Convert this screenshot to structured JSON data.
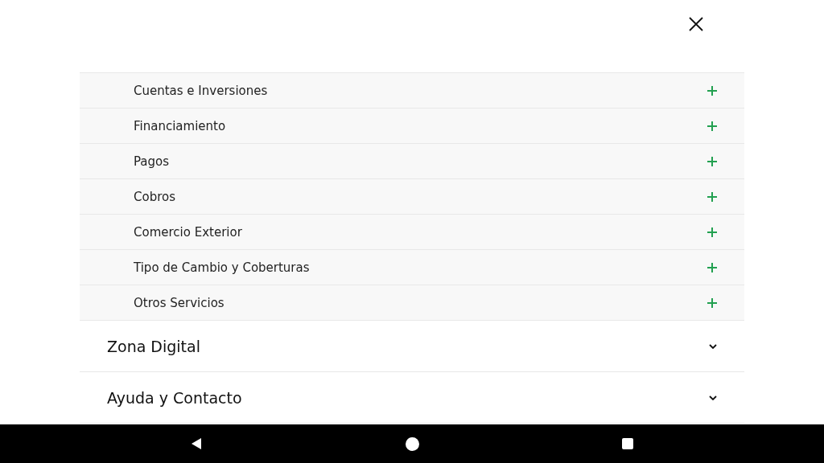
{
  "submenu": [
    {
      "label": "Cuentas e Inversiones",
      "expanded": false
    },
    {
      "label": "Financiamiento",
      "expanded": false
    },
    {
      "label": "Pagos",
      "expanded": false
    },
    {
      "label": "Cobros",
      "expanded": false
    },
    {
      "label": "Comercio Exterior",
      "expanded": false
    },
    {
      "label": "Tipo de Cambio y Coberturas",
      "expanded": false
    },
    {
      "label": "Otros Servicios",
      "expanded": false
    }
  ],
  "sections": [
    {
      "label": "Zona Digital",
      "expanded": false
    },
    {
      "label": "Ayuda y Contacto",
      "expanded": false
    }
  ]
}
